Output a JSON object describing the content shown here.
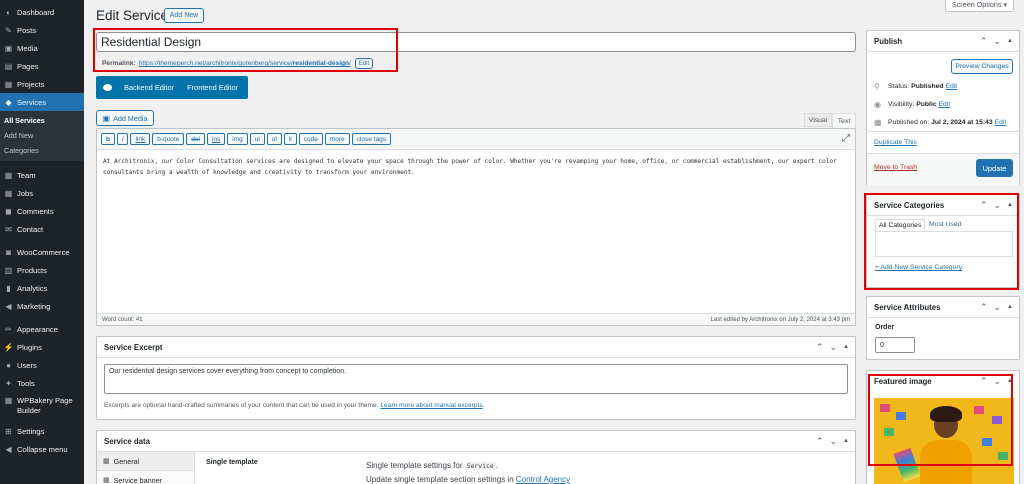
{
  "sidebar": {
    "items": [
      {
        "label": "Dashboard",
        "icon": "dashboard-icon",
        "glyph": "◐"
      },
      {
        "label": "Posts",
        "icon": "pin-icon",
        "glyph": "✎"
      },
      {
        "label": "Media",
        "icon": "media-icon",
        "glyph": "▣"
      },
      {
        "label": "Pages",
        "icon": "pages-icon",
        "glyph": "▤"
      },
      {
        "label": "Projects",
        "icon": "projects-icon",
        "glyph": "▦"
      },
      {
        "label": "Services",
        "icon": "services-icon",
        "glyph": "◆"
      },
      {
        "label": "Team",
        "icon": "team-icon",
        "glyph": "▦"
      },
      {
        "label": "Jobs",
        "icon": "jobs-icon",
        "glyph": "▦"
      },
      {
        "label": "Comments",
        "icon": "comments-icon",
        "glyph": "◼"
      },
      {
        "label": "Contact",
        "icon": "contact-icon",
        "glyph": "✉"
      },
      {
        "label": "WooCommerce",
        "icon": "woocommerce-icon",
        "glyph": "◙"
      },
      {
        "label": "Products",
        "icon": "products-icon",
        "glyph": "▥"
      },
      {
        "label": "Analytics",
        "icon": "analytics-icon",
        "glyph": "▮"
      },
      {
        "label": "Marketing",
        "icon": "marketing-icon",
        "glyph": "◀"
      },
      {
        "label": "Appearance",
        "icon": "appearance-icon",
        "glyph": "✏"
      },
      {
        "label": "Plugins",
        "icon": "plugins-icon",
        "glyph": "⚡"
      },
      {
        "label": "Users",
        "icon": "users-icon",
        "glyph": "●"
      },
      {
        "label": "Tools",
        "icon": "tools-icon",
        "glyph": "✦"
      },
      {
        "label": "WPBakery Page Builder",
        "icon": "wpbakery-icon",
        "glyph": "▦"
      },
      {
        "label": "Settings",
        "icon": "settings-icon",
        "glyph": "⊞"
      },
      {
        "label": "Collapse menu",
        "icon": "collapse-icon",
        "glyph": "◀"
      }
    ],
    "submenu": [
      "All Services",
      "Add New",
      "Categories"
    ]
  },
  "header": {
    "title": "Edit Service",
    "add_new": "Add New",
    "screen_options": "Screen Options ▾"
  },
  "post": {
    "title": "Residential Design",
    "permalink_label": "Permalink:",
    "permalink_base": "https://themeperch.net/architronix/gutenberg/service/",
    "permalink_slug": "residential-design",
    "permalink_end": "/",
    "edit_label": "Edit"
  },
  "builder": {
    "backend": "Backend Editor",
    "frontend": "Frontend Editor"
  },
  "editor": {
    "add_media": "Add Media",
    "tab_visual": "Visual",
    "tab_text": "Text",
    "quicktags": [
      "b",
      "i",
      "link",
      "b-quote",
      "del",
      "ins",
      "img",
      "ul",
      "ol",
      "li",
      "code",
      "more",
      "close tags"
    ],
    "content": "At Architronix, our Color Consultation services are designed to elevate your space through the power of color. Whether you're revamping your home, office, or commercial establishment, our expert color consultants bring a wealth of knowledge and creativity to transform your environment.",
    "word_count": "Word count: 41",
    "last_edited": "Last edited by Architronix on July 2, 2024 at 3:43 pm"
  },
  "excerpt": {
    "title": "Service Excerpt",
    "value": "Our residential design services cover everything from concept to completion.",
    "help": "Excerpts are optional hand-crafted summaries of your content that can be used in your theme.",
    "help_link": "Learn more about manual excerpts",
    "help_end": "."
  },
  "service_data": {
    "title": "Service data",
    "tabs": [
      "General",
      "Service banner"
    ],
    "field_label": "Single template",
    "desc1_pre": "Single template settings for",
    "desc1_code": "Service",
    "desc1_post": ".",
    "desc2_pre": "Update single template section settings in",
    "desc2_link": "Control Agency"
  },
  "publish": {
    "title": "Publish",
    "preview": "Preview Changes",
    "status_label": "Status:",
    "status_value": "Published",
    "visibility_label": "Visibility:",
    "visibility_value": "Public",
    "published_label": "Published on:",
    "published_value": "Jul 2, 2024 at 15:43",
    "edit": "Edit",
    "duplicate": "Duplicate This",
    "trash": "Move to Trash",
    "update": "Update"
  },
  "categories": {
    "title": "Service Categories",
    "tab_all": "All Categories",
    "tab_used": "Most Used",
    "add_new": "+ Add New Service Category"
  },
  "attributes": {
    "title": "Service Attributes",
    "order_label": "Order",
    "order_value": "0"
  },
  "featured": {
    "title": "Featured image"
  },
  "colors": {
    "sidebar": "#1d2327",
    "active": "#2271b1",
    "highlight": "#e00000",
    "update": "#2271b1",
    "trash": "#b32d2e",
    "featured_bg": "#f2b718"
  }
}
